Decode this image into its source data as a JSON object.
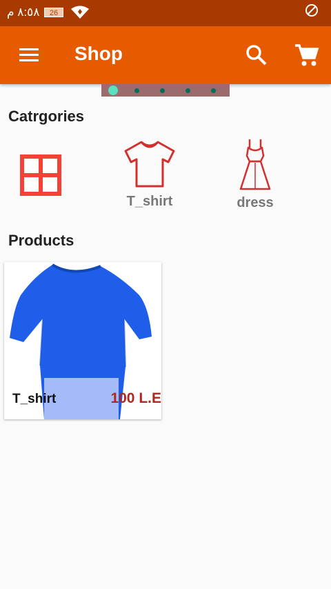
{
  "status_bar": {
    "time": "٨:٥٨ م",
    "battery": "26"
  },
  "app_bar": {
    "title": "Shop",
    "accent_color": "#e65a00"
  },
  "categories_section": {
    "title": "Catrgories",
    "items": [
      {
        "label": "",
        "icon": "grid-icon"
      },
      {
        "label": "T_shirt",
        "icon": "tshirt-icon"
      },
      {
        "label": "dress",
        "icon": "dress-icon"
      }
    ]
  },
  "products_section": {
    "title": "Products",
    "items": [
      {
        "name": "T_shirt",
        "price": "100 L.E",
        "image": "blue-tshirt-image"
      }
    ]
  }
}
